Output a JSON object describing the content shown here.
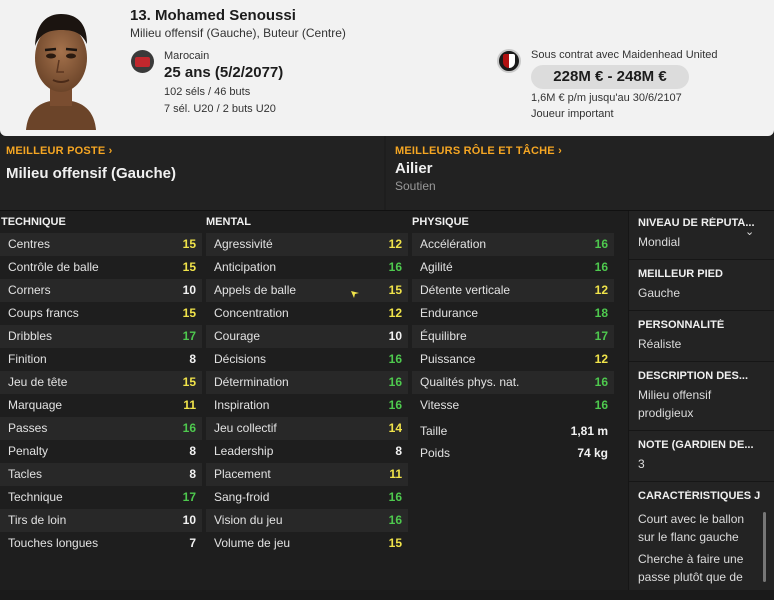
{
  "player": {
    "name": "13. Mohamed Senoussi",
    "positions": "Milieu offensif (Gauche), Buteur (Centre)",
    "nationality": "Marocain",
    "age": "25 ans (5/2/2077)",
    "caps": "102 séls / 46 buts",
    "u20_caps": "7 sél. U20 / 2 buts U20",
    "contract": "Sous contrat avec Maidenhead United",
    "value": "228M € - 248M €",
    "wage": "1,6M € p/m jusqu'au 30/6/2107",
    "status": "Joueur important"
  },
  "best_position": {
    "header": "MEILLEUR POSTE",
    "value": "Milieu offensif (Gauche)"
  },
  "best_role": {
    "header": "MEILLEURS RÔLE ET TÂCHE",
    "value": "Ailier",
    "duty": "Soutien"
  },
  "technique": {
    "header": "TECHNIQUE",
    "rows": [
      {
        "label": "Centres",
        "value": "15"
      },
      {
        "label": "Contrôle de balle",
        "value": "15"
      },
      {
        "label": "Corners",
        "value": "10"
      },
      {
        "label": "Coups francs",
        "value": "15"
      },
      {
        "label": "Dribbles",
        "value": "17"
      },
      {
        "label": "Finition",
        "value": "8"
      },
      {
        "label": "Jeu de tête",
        "value": "15"
      },
      {
        "label": "Marquage",
        "value": "11"
      },
      {
        "label": "Passes",
        "value": "16"
      },
      {
        "label": "Penalty",
        "value": "8"
      },
      {
        "label": "Tacles",
        "value": "8"
      },
      {
        "label": "Technique",
        "value": "17"
      },
      {
        "label": "Tirs de loin",
        "value": "10"
      },
      {
        "label": "Touches longues",
        "value": "7"
      }
    ]
  },
  "mental": {
    "header": "MENTAL",
    "rows": [
      {
        "label": "Agressivité",
        "value": "12"
      },
      {
        "label": "Anticipation",
        "value": "16"
      },
      {
        "label": "Appels de balle",
        "value": "15"
      },
      {
        "label": "Concentration",
        "value": "12"
      },
      {
        "label": "Courage",
        "value": "10"
      },
      {
        "label": "Décisions",
        "value": "16"
      },
      {
        "label": "Détermination",
        "value": "16"
      },
      {
        "label": "Inspiration",
        "value": "16"
      },
      {
        "label": "Jeu collectif",
        "value": "14"
      },
      {
        "label": "Leadership",
        "value": "8"
      },
      {
        "label": "Placement",
        "value": "11"
      },
      {
        "label": "Sang-froid",
        "value": "16"
      },
      {
        "label": "Vision du jeu",
        "value": "16"
      },
      {
        "label": "Volume de jeu",
        "value": "15"
      }
    ]
  },
  "physique": {
    "header": "PHYSIQUE",
    "rows": [
      {
        "label": "Accélération",
        "value": "16"
      },
      {
        "label": "Agilité",
        "value": "16"
      },
      {
        "label": "Détente verticale",
        "value": "12"
      },
      {
        "label": "Endurance",
        "value": "18"
      },
      {
        "label": "Équilibre",
        "value": "17"
      },
      {
        "label": "Puissance",
        "value": "12"
      },
      {
        "label": "Qualités phys. nat.",
        "value": "16"
      },
      {
        "label": "Vitesse",
        "value": "16"
      }
    ],
    "height_label": "Taille",
    "height": "1,81 m",
    "weight_label": "Poids",
    "weight": "74 kg"
  },
  "sidebar": {
    "reputation_header": "NIVEAU DE RÉPUTA...",
    "reputation": "Mondial",
    "foot_header": "MEILLEUR PIED",
    "foot": "Gauche",
    "personality_header": "PERSONNALITÉ",
    "personality": "Réaliste",
    "description_header": "DESCRIPTION DES...",
    "description": "Milieu offensif prodigieux",
    "gk_header": "NOTE (GARDIEN DE...",
    "gk": "3",
    "traits_header": "CARACTÉRISTIQUES J",
    "trait1": "Court avec le ballon sur le flanc gauche",
    "trait2": "Cherche à faire une passe plutôt que de"
  },
  "colors": {
    "high": "#4ec94e",
    "mid": "#f0e34a",
    "low": "#f2f2f2",
    "accent": "#f5a623"
  }
}
